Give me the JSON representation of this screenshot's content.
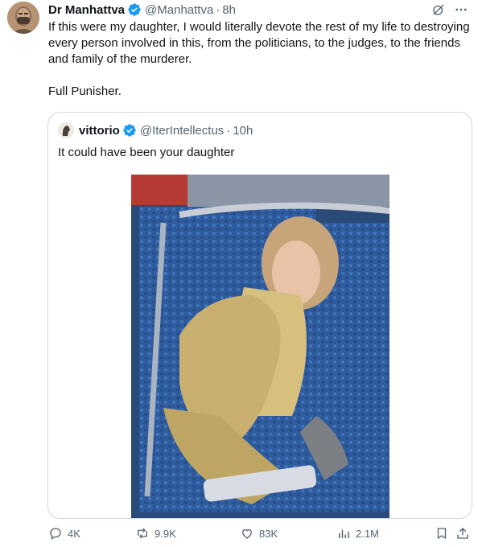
{
  "tweet": {
    "author_name": "Dr Manhattva",
    "author_handle": "@Manhattva",
    "separator": "·",
    "time": "8h",
    "text_paragraph_1": "If this were my daughter, I would literally devote the rest of my life to destroying every person involved in this, from the politicians, to the judges, to the friends and family of the murderer.",
    "text_paragraph_2": "Full Punisher."
  },
  "quote": {
    "author_name": "vittorio",
    "author_handle": "@IterIntellectus",
    "separator": "·",
    "time": "10h",
    "text": "It could have been your daughter"
  },
  "actions": {
    "replies": "4K",
    "reposts": "9.9K",
    "likes": "83K",
    "views": "2.1M"
  },
  "colors": {
    "verified": "#1d9bf0",
    "text": "#0f1419",
    "muted": "#536471",
    "border": "#cfd9de"
  },
  "icons": [
    "verified-badge-icon",
    "grok-icon",
    "more-icon",
    "reply-icon",
    "repost-icon",
    "like-icon",
    "views-icon",
    "bookmark-icon",
    "share-icon"
  ]
}
